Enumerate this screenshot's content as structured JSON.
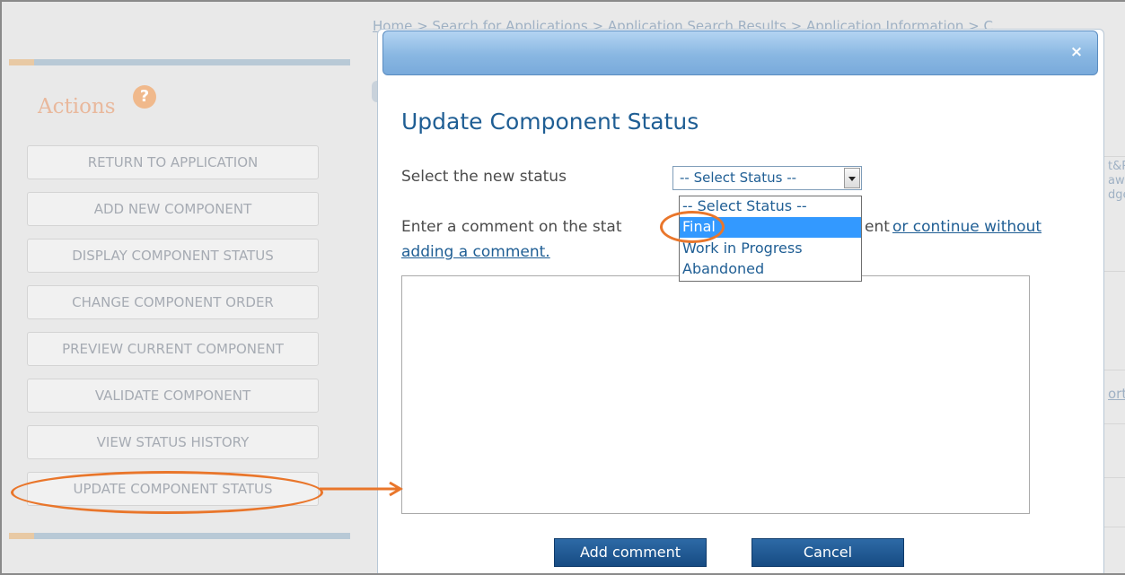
{
  "breadcrumb": "Home > Search for Applications > Application Search Results > Application Information > C",
  "actions": {
    "title": "Actions",
    "help_icon": "?",
    "buttons": [
      "RETURN TO APPLICATION",
      "ADD NEW COMPONENT",
      "DISPLAY COMPONENT STATUS",
      "CHANGE COMPONENT ORDER",
      "PREVIEW CURRENT COMPONENT",
      "VALIDATE COMPONENT",
      "VIEW STATUS HISTORY",
      "UPDATE COMPONENT STATUS"
    ]
  },
  "right_fragments": [
    "t&R",
    "awa",
    "dge",
    "ort"
  ],
  "modal": {
    "close_icon": "×",
    "title": "Update Component Status",
    "status_label": "Select the new status",
    "select": {
      "value": "-- Select Status --",
      "options": [
        "-- Select Status --",
        "Final",
        "Work in Progress",
        "Abandoned"
      ],
      "highlighted": "Final"
    },
    "comment_text_start": "Enter a comment on the stat",
    "comment_text_end": "ent",
    "continue_link_part1": "or continue without",
    "continue_link_part2": "adding a comment.",
    "comment_value": "",
    "add_button": "Add comment",
    "cancel_button": "Cancel"
  },
  "colors": {
    "accent": "#1f5e94",
    "annotation": "#e9762b",
    "selection": "#3399ff",
    "button": "#1f5b97"
  }
}
